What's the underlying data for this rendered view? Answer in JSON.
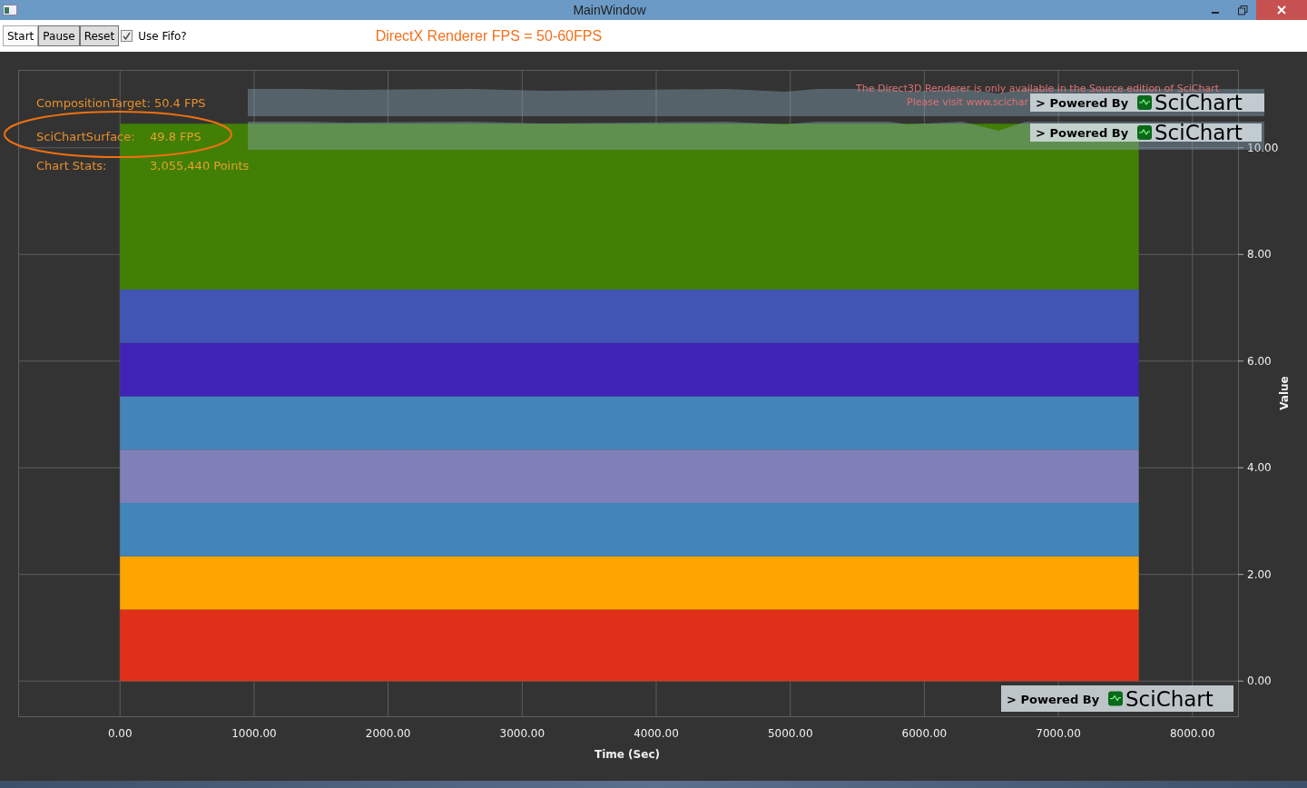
{
  "window": {
    "title": "MainWindow"
  },
  "toolbar": {
    "buttons": [
      {
        "label": "Start",
        "highlighted": true
      },
      {
        "label": "Pause",
        "highlighted": false
      },
      {
        "label": "Reset",
        "highlighted": false
      }
    ],
    "checkbox": {
      "label": "Use Fifo?",
      "checked": true
    },
    "fps_label": "DirectX Renderer FPS = 50-60FPS"
  },
  "chart": {
    "stats": [
      {
        "label": "CompositionTarget: 50.4 FPS",
        "circled": false
      },
      {
        "label": "SciChartSurface:",
        "value": "49.8 FPS",
        "circled": true
      },
      {
        "label": "Chart Stats:",
        "value": "3,055,440 Points",
        "circled": false
      }
    ],
    "notice": [
      "The Direct3D Renderer is only available in the Source edition of SciChart",
      "Please visit www.scichar"
    ],
    "badges": [
      {
        "prefix": "> Powered By",
        "brand": "SciChart"
      },
      {
        "prefix": "> Powered By",
        "brand": "SciChart"
      },
      {
        "prefix": "> Powered By",
        "brand": "SciChart"
      }
    ],
    "chart_data": {
      "type": "area",
      "stacked": true,
      "grid": true,
      "xlabel": "Time (Sec)",
      "ylabel": "Value",
      "x": [
        0,
        7600
      ],
      "xlim": [
        -760,
        8340
      ],
      "ylim": [
        -0.66,
        11.46
      ],
      "xticks": [
        {
          "value": 0,
          "label": "0.00"
        },
        {
          "value": 1000,
          "label": "1000.00"
        },
        {
          "value": 2000,
          "label": "2000.00"
        },
        {
          "value": 3000,
          "label": "3000.00"
        },
        {
          "value": 4000,
          "label": "4000.00"
        },
        {
          "value": 5000,
          "label": "5000.00"
        },
        {
          "value": 6000,
          "label": "6000.00"
        },
        {
          "value": 7000,
          "label": "7000.00"
        },
        {
          "value": 8000,
          "label": "8000.00"
        }
      ],
      "yticks": [
        {
          "value": 0,
          "label": "0.00"
        },
        {
          "value": 2,
          "label": "2.00"
        },
        {
          "value": 4,
          "label": "4.00"
        },
        {
          "value": 6,
          "label": "6.00"
        },
        {
          "value": 8,
          "label": "8.00"
        },
        {
          "value": 10,
          "label": "10.00"
        }
      ],
      "series": [
        {
          "color": "#e0301a",
          "values": [
            1.34,
            1.34
          ]
        },
        {
          "color": "#ffa500",
          "values": [
            1.0,
            1.0
          ]
        },
        {
          "color": "#4185ba",
          "values": [
            1.0,
            1.0
          ]
        },
        {
          "color": "#8080b8",
          "values": [
            1.0,
            1.0
          ]
        },
        {
          "color": "#4385bb",
          "values": [
            1.0,
            1.0
          ]
        },
        {
          "color": "#3f23b6",
          "values": [
            1.0,
            1.0
          ]
        },
        {
          "color": "#4155b5",
          "values": [
            1.0,
            1.0
          ]
        },
        {
          "color": "#417f05",
          "values": [
            3.11,
            3.11
          ]
        }
      ]
    }
  }
}
